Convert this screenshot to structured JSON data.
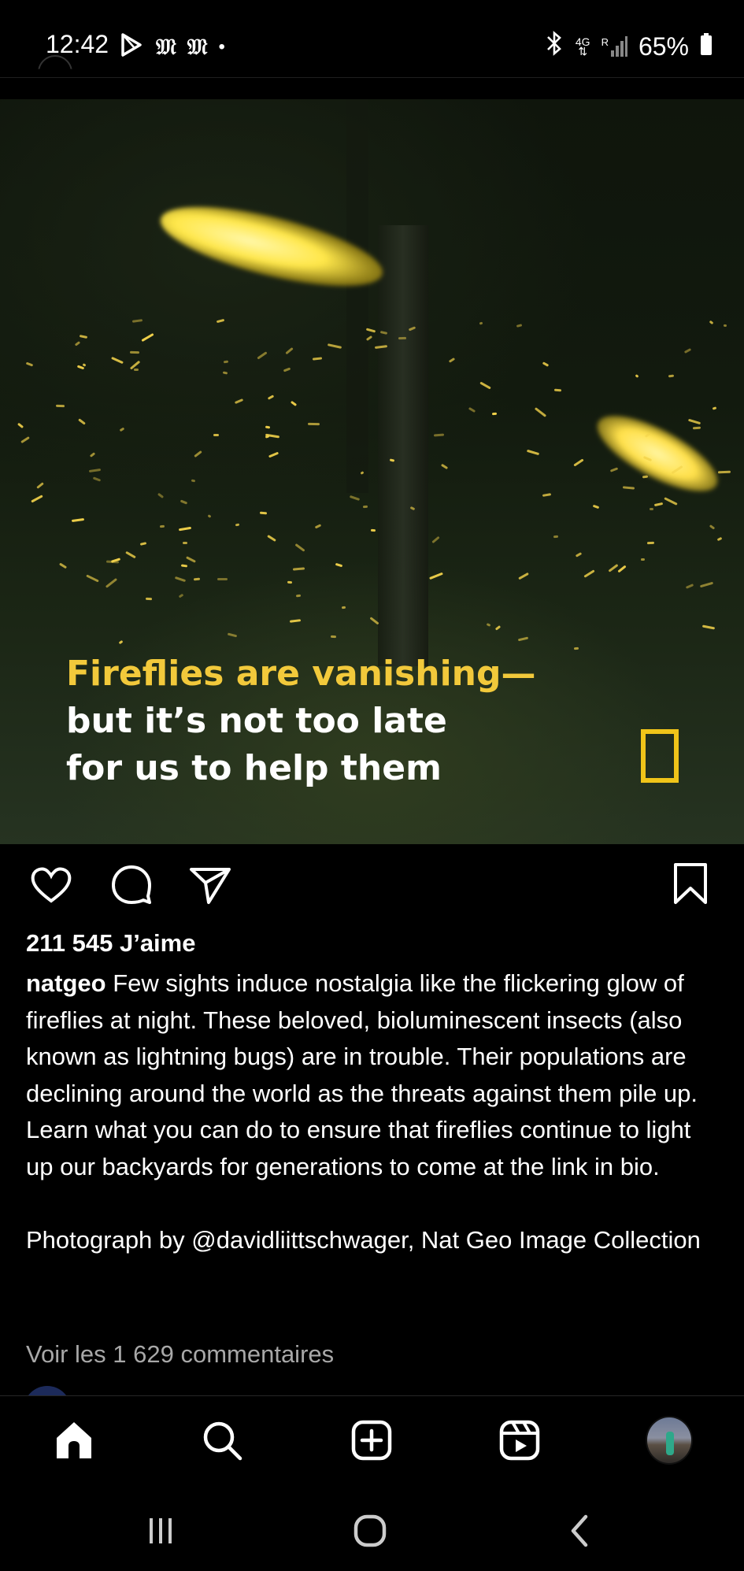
{
  "status_bar": {
    "time": "12:42",
    "left_icons": [
      "play-store-icon",
      "nytimes-icon",
      "nytimes-icon",
      "dot-icon"
    ],
    "network": "4G",
    "roaming": "R",
    "battery": "65%"
  },
  "post": {
    "image": {
      "overlay_line1": "Fireflies are vanishing—",
      "overlay_line2": "but it’s not too late",
      "overlay_line3": "for us to help them",
      "accent_color": "#f2c93b"
    },
    "actions": {
      "like_icon": "heart-icon",
      "comment_icon": "comment-icon",
      "share_icon": "paper-plane-icon",
      "save_icon": "bookmark-icon"
    },
    "likes": "211 545 J’aime",
    "username": "natgeo",
    "caption": "Few sights induce nostalgia like the flickering glow of fireflies at night. These beloved, bioluminescent insects (also known as lightning bugs) are in trouble. Their populations are declining around the world as the threats against them pile up. Learn what you can do to ensure that fireflies continue to light up our backyards for generations to come at the link in bio.",
    "credit": "Photograph by @davidliittschwager, Nat Geo Image Collection",
    "view_comments": "Voir les 1 629 commentaires"
  },
  "bottom_nav": [
    "home-icon",
    "search-icon",
    "create-icon",
    "reels-icon",
    "profile-avatar"
  ],
  "system_nav": [
    "recents-icon",
    "home-circle-icon",
    "back-icon"
  ]
}
